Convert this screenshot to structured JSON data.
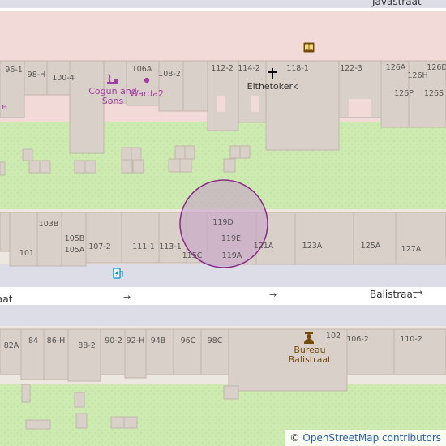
{
  "streets": {
    "javastraat": "Javastraat",
    "balistraat": "Balistraat",
    "west_fragment": "aat"
  },
  "house_numbers": {
    "top_row": [
      "96-1",
      "98-H",
      "100-4",
      "106A",
      "108-2",
      "112-2",
      "114-2",
      "118-1",
      "122-3",
      "126A",
      "126D",
      "126H",
      "126P",
      "126S"
    ],
    "middle_row": [
      "103B",
      "105B",
      "105A",
      "101",
      "107-2",
      "111-1",
      "113-1",
      "115C",
      "119D",
      "119E",
      "119A",
      "121A",
      "123A",
      "125A",
      "127A"
    ],
    "bottom_row": [
      "82A",
      "84",
      "86-H",
      "88-2",
      "90-2",
      "92-H",
      "94B",
      "96C",
      "98C",
      "102",
      "106-2",
      "110-2"
    ]
  },
  "pois": {
    "cogun": "Cogun and Sons",
    "warda": "Warda2",
    "church": "Elthetokerk",
    "bureau": "Bureau Balistraat",
    "left_fragment": "e"
  },
  "icons": {
    "cogun": "hookah-icon",
    "warda": "dot-icon",
    "church": "cross-icon",
    "library": "book-icon",
    "charging": "charging-station-icon",
    "police": "police-icon"
  },
  "oneway_arrow": "→",
  "attribution": {
    "symbol": "©",
    "text": "OpenStreetMap contributors"
  },
  "colors": {
    "background": "#f2efe9",
    "park": "#cdebb0",
    "building": "#d9d0c9",
    "building_outline": "#c4b6ab",
    "road": "#ffffff",
    "pedestrian": "#dddde8",
    "commercial": "#f2dad9",
    "highlight_fill": "#c8a8c8",
    "highlight_stroke": "#8a2a8a"
  }
}
